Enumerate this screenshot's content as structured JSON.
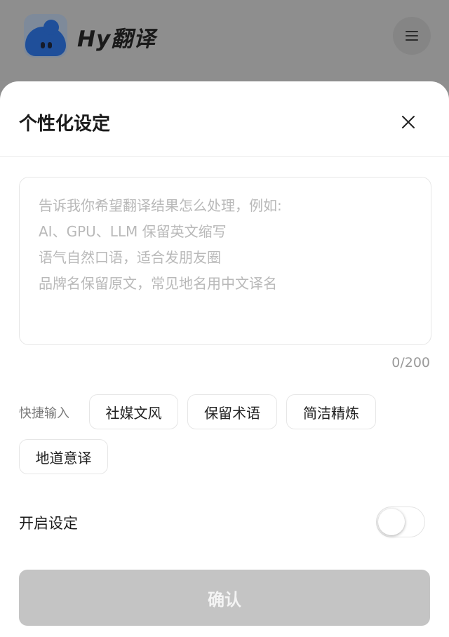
{
  "app": {
    "title": "Hy翻译"
  },
  "sheet": {
    "title": "个性化设定",
    "placeholder_lines": [
      "告诉我你希望翻译结果怎么处理，例如:",
      "AI、GPU、LLM 保留英文缩写",
      "语气自然口语，适合发朋友圈",
      "品牌名保留原文，常见地名用中文译名"
    ],
    "counter": "0/200",
    "quick_input": {
      "label": "快捷输入",
      "chips": [
        "社媒文风",
        "保留术语",
        "简洁精炼",
        "地道意译"
      ]
    },
    "toggle": {
      "label": "开启设定",
      "on": false
    },
    "confirm_label": "确认"
  },
  "colors": {
    "overlay": "#8f8f8f",
    "sheet_bg": "#ffffff",
    "placeholder": "#b9b9b9",
    "confirm_disabled": "#c4c4c4",
    "logo_blue": "#1f4f9a"
  },
  "icons": {
    "menu": "hamburger-menu-icon",
    "close": "close-icon",
    "logo": "app-logo-icon"
  }
}
